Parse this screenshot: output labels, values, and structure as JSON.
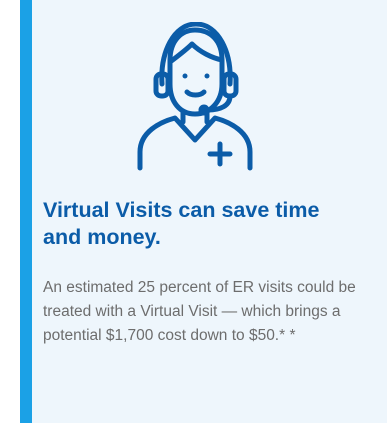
{
  "card": {
    "icon": "doctor-headset-icon",
    "headline": "Virtual Visits can save time and money.",
    "body": "An estimated 25 percent of ER visits could be treated with a Virtual Visit — which brings a potential $1,700 cost down to $50.* *"
  },
  "colors": {
    "accent": "#1ba1e6",
    "background": "#eef6fc",
    "headline": "#0b5ca8",
    "icon": "#0b5ca8",
    "body": "#6d6d6d"
  }
}
